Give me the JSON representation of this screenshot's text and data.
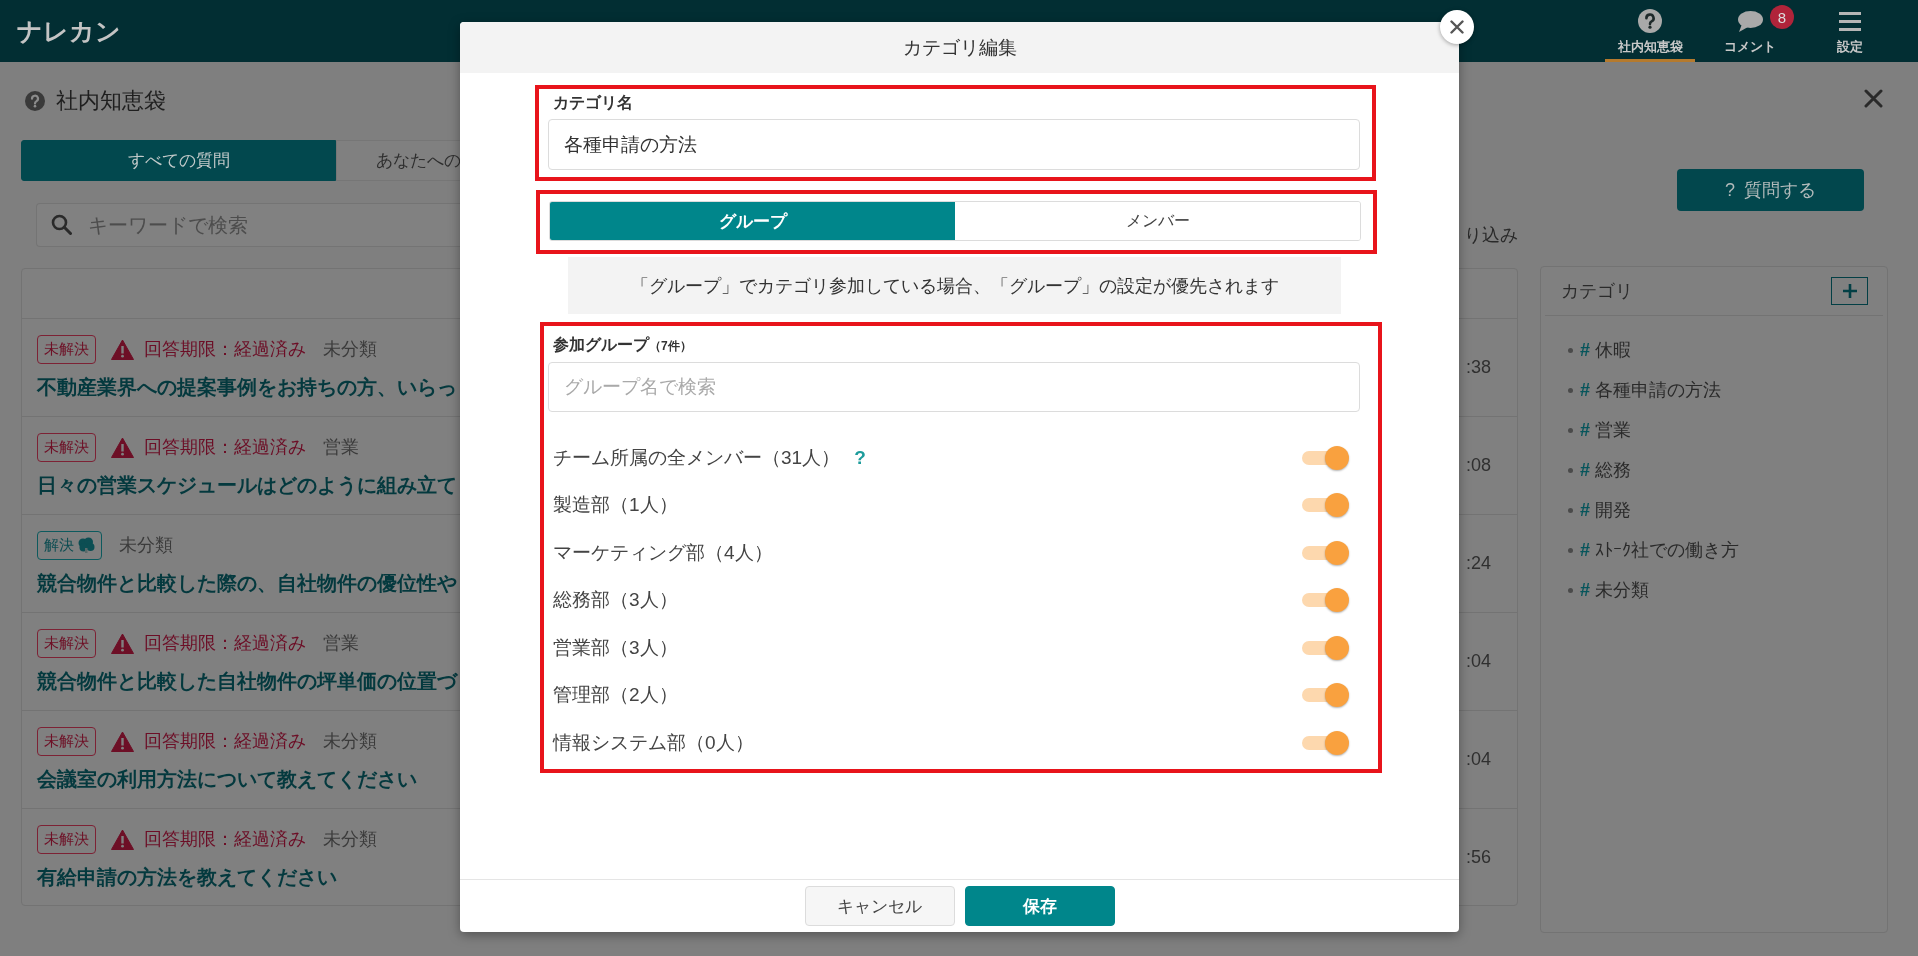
{
  "header": {
    "logo": "ナレカン",
    "nav": [
      {
        "label": "社内知恵袋",
        "selected": true
      },
      {
        "label": "コメント",
        "badge": "8",
        "selected": false
      },
      {
        "label": "設定",
        "selected": false
      }
    ]
  },
  "page": {
    "title": "社内知恵袋",
    "tabs": [
      {
        "label": "すべての質問",
        "selected": true
      },
      {
        "label": "あなたへの",
        "selected": false
      }
    ],
    "search": {
      "placeholder": "キーワードで検索"
    },
    "filter_link": "り込み",
    "ask_button": {
      "icon": "?",
      "label": "質問する"
    },
    "questions": [
      {
        "status": {
          "kind": "unresolved",
          "label": "未解決"
        },
        "deadline": "回答期限：経過済み",
        "category": "未分類",
        "title": "不動産業界への提案事例をお持ちの方、いらっ",
        "time": ":38"
      },
      {
        "status": {
          "kind": "unresolved",
          "label": "未解決"
        },
        "deadline": "回答期限：経過済み",
        "category": "営業",
        "title": "日々の営業スケジュールはどのように組み立て",
        "time": ":08"
      },
      {
        "status": {
          "kind": "resolved",
          "label": "解決"
        },
        "category": "未分類",
        "title": "競合物件と比較した際の、自社物件の優位性や",
        "time": ":24"
      },
      {
        "status": {
          "kind": "unresolved",
          "label": "未解決"
        },
        "deadline": "回答期限：経過済み",
        "category": "営業",
        "title": "競合物件と比較した自社物件の坪単価の位置づ",
        "time": ":04"
      },
      {
        "status": {
          "kind": "unresolved",
          "label": "未解決"
        },
        "deadline": "回答期限：経過済み",
        "category": "未分類",
        "title": "会議室の利用方法について教えてください",
        "time": ":04"
      },
      {
        "status": {
          "kind": "unresolved",
          "label": "未解決"
        },
        "deadline": "回答期限：経過済み",
        "category": "未分類",
        "title": "有給申請の方法を教えてください",
        "time": ":56"
      }
    ]
  },
  "categories": {
    "title": "カテゴリ",
    "items": [
      {
        "mark": "#",
        "label": "休暇"
      },
      {
        "mark": "#",
        "label": "各種申請の方法"
      },
      {
        "mark": "#",
        "label": "営業"
      },
      {
        "mark": "#",
        "label": "総務"
      },
      {
        "mark": "#",
        "label": "開発"
      },
      {
        "mark": "#",
        "label": "ｽﾄｰｸ社での働き方"
      },
      {
        "mark": "#",
        "label": "未分類"
      }
    ]
  },
  "modal": {
    "title": "カテゴリ編集",
    "name_field": {
      "highlighted": true,
      "label": "カテゴリ名",
      "value": "各種申請の方法"
    },
    "scope": {
      "highlighted": true,
      "options": [
        {
          "label": "グループ",
          "selected": true
        },
        {
          "label": "メンバー",
          "selected": false
        }
      ]
    },
    "notice": "「グループ」でカテゴリ参加している場合、「グループ」の設定が優先されます",
    "groups": {
      "highlighted": true,
      "label": "参加グループ",
      "count": "（7件）",
      "search": {
        "placeholder": "グループ名で検索"
      },
      "items": [
        {
          "name": "チーム所属の全メンバー（31人）",
          "help": "?",
          "on": true
        },
        {
          "name": "製造部（1人）",
          "on": true
        },
        {
          "name": "マーケティング部（4人）",
          "on": true
        },
        {
          "name": "総務部（3人）",
          "on": true
        },
        {
          "name": "営業部（3人）",
          "on": true
        },
        {
          "name": "管理部（2人）",
          "on": true
        },
        {
          "name": "情報システム部（0人）",
          "on": true
        }
      ]
    },
    "buttons": [
      {
        "kind": "secondary",
        "label": "キャンセル"
      },
      {
        "kind": "primary",
        "label": "保存"
      }
    ]
  }
}
